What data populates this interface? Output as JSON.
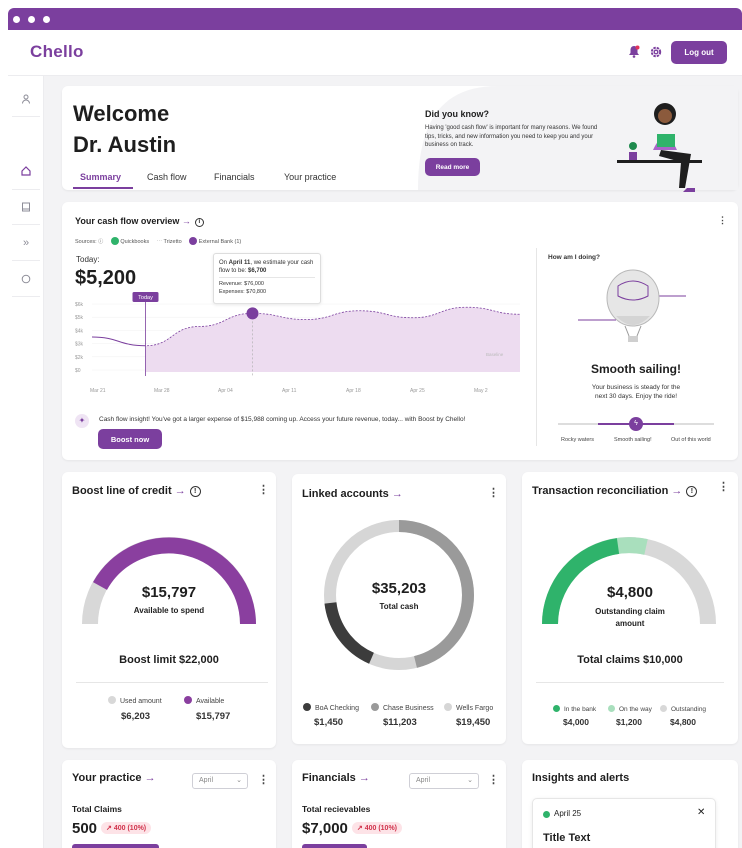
{
  "app": {
    "logo": "Chello",
    "logout_label": "Log out"
  },
  "welcome": {
    "line1": "Welcome",
    "line2": "Dr. Austin"
  },
  "tabs": [
    "Summary",
    "Cash flow",
    "Financials",
    "Your practice"
  ],
  "did_you_know": {
    "title": "Did you know?",
    "body": "Having 'good cash flow' is important for many reasons. We found tips, tricks, and new information you need to keep you and your business on track.",
    "button": "Read more"
  },
  "cashflow": {
    "title": "Your cash flow overview",
    "sources_label": "Sources:",
    "sources": [
      "Quickbooks",
      "Trizetto",
      "External Bank (1)"
    ],
    "today_label": "Today:",
    "today_value": "$5,200",
    "tooltip": {
      "prefix": "On ",
      "date": "April 11",
      "mid": ", we estimate your cash flow to be: ",
      "value": "$6,700",
      "revenue": "Revenue: $76,000",
      "expenses": "Expenses: $70,800"
    },
    "today_marker": "Today",
    "baseline": "Baseline",
    "insight": "Cash flow insight! You've got a larger expense of $15,988 coming up. Access your future revenue, today... with Boost by Chello!",
    "boost_button": "Boost now"
  },
  "chart_data": {
    "type": "area",
    "x": [
      "Mar 21",
      "Mar 28",
      "Apr 04",
      "Apr 11",
      "Apr 18",
      "Apr 25",
      "May 2"
    ],
    "y_ticks": [
      "$6k",
      "$5k",
      "$4k",
      "$3k",
      "$2k",
      "$0"
    ],
    "series": [
      {
        "values": [
          4.0,
          3.0,
          5.2,
          6.7,
          6.0,
          7.0,
          6.2,
          7.4,
          6.6
        ]
      }
    ],
    "today_index": 1
  },
  "how_am_i_doing": {
    "title": "How am I doing?",
    "status": "Smooth sailing!",
    "desc": "Your business is steady for the next 30 days. Enjoy the ride!",
    "scale": [
      "Rocky waters",
      "Smooth sailing!",
      "Out of this world"
    ],
    "level": 0.5
  },
  "boost": {
    "title": "Boost line of credit",
    "amount": "$15,797",
    "amount_label": "Available to spend",
    "limit": "Boost limit $22,000",
    "legend": [
      {
        "label": "Used amount",
        "value": "$6,203",
        "color": "#d8d8d8"
      },
      {
        "label": "Available",
        "value": "$15,797",
        "color": "#8a3f9f"
      }
    ]
  },
  "linked": {
    "title": "Linked accounts",
    "amount": "$35,203",
    "amount_label": "Total cash",
    "legend": [
      {
        "label": "BoA Checking",
        "value": "$1,450",
        "color": "#3c3c3c"
      },
      {
        "label": "Chase Business",
        "value": "$11,203",
        "color": "#9a9a9a"
      },
      {
        "label": "Wells Fargo",
        "value": "$19,450",
        "color": "#d6d6d6"
      }
    ]
  },
  "recon": {
    "title": "Transaction reconciliation",
    "amount": "$4,800",
    "amount_label": "Outstanding claim amount",
    "total": "Total claims $10,000",
    "legend": [
      {
        "label": "In the bank",
        "value": "$4,000",
        "color": "#2fb36b"
      },
      {
        "label": "On the way",
        "value": "$1,200",
        "color": "#a9dfbd"
      },
      {
        "label": "Outstanding",
        "value": "$4,800",
        "color": "#d8d8d8"
      }
    ]
  },
  "practice": {
    "title": "Your practice",
    "select": "April",
    "metric_label": "Total Claims",
    "metric": "500",
    "delta": "400 (10%)"
  },
  "financials": {
    "title": "Financials",
    "select": "April",
    "metric_label": "Total recievables",
    "metric": "$7,000",
    "delta": "400 (10%)"
  },
  "insights": {
    "title": "Insights and alerts",
    "date": "April 25",
    "item_title": "Title Text"
  }
}
